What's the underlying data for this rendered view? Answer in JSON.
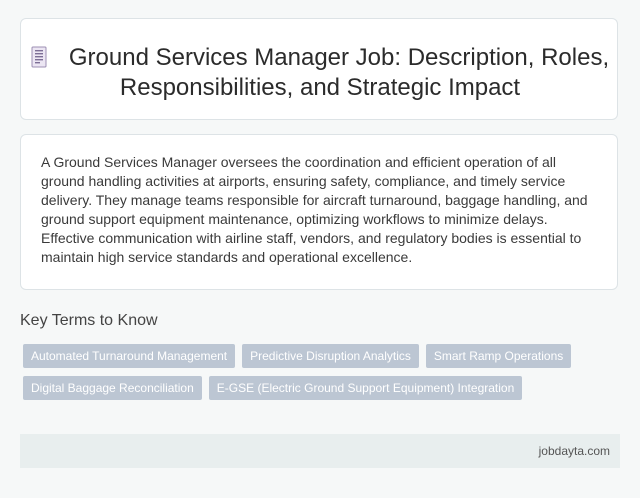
{
  "header": {
    "icon": "document-icon",
    "title": "Ground Services Manager Job: Description, Roles, Responsibilities, and Strategic Impact"
  },
  "description": {
    "text": "A Ground Services Manager oversees the coordination and efficient operation of all ground handling activities at airports, ensuring safety, compliance, and timely service delivery. They manage teams responsible for aircraft turnaround, baggage handling, and ground support equipment maintenance, optimizing workflows to minimize delays. Effective communication with airline staff, vendors, and regulatory bodies is essential to maintain high service standards and operational excellence."
  },
  "key_terms": {
    "heading": "Key Terms to Know",
    "tags": [
      "Automated Turnaround Management",
      "Predictive Disruption Analytics",
      "Smart Ramp Operations",
      "Digital Baggage Reconciliation",
      "E-GSE (Electric Ground Support Equipment) Integration"
    ]
  },
  "footer": {
    "site": "jobdayta.com"
  },
  "colors": {
    "background": "#f6f8f8",
    "tag_bg": "#bcc6d3",
    "footer_bg": "#e8eeee"
  }
}
